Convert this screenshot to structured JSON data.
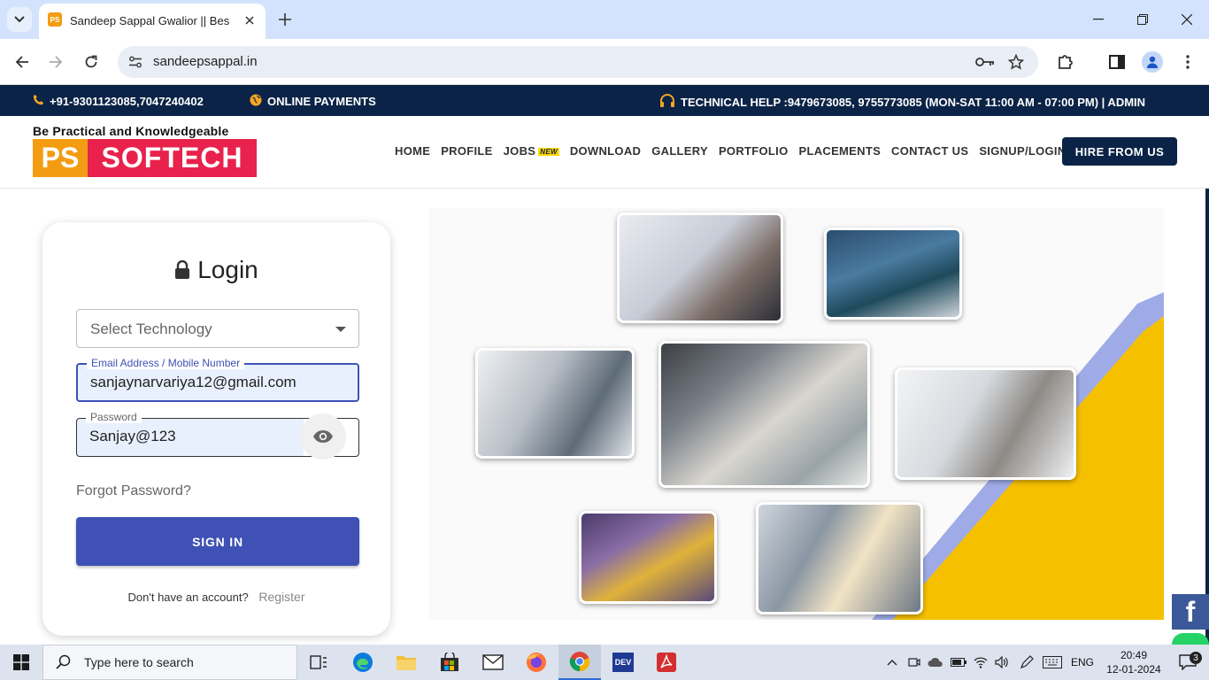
{
  "browser": {
    "tab_title": "Sandeep Sappal Gwalior || Best",
    "url": "sandeepsappal.in"
  },
  "topbar": {
    "phone": "+91-9301123085,7047240402",
    "payments": "ONLINE PAYMENTS",
    "help": "TECHNICAL HELP :9479673085, 9755773085 (MON-SAT 11:00 AM - 07:00 PM) | ADMIN"
  },
  "header": {
    "tagline": "Be Practical and Knowledgeable",
    "logo_ps": "PS",
    "logo_softech": "SOFTECH",
    "nav": {
      "home": "HOME",
      "profile": "PROFILE",
      "jobs": "JOBS",
      "jobs_badge": "NEW",
      "download": "DOWNLOAD",
      "gallery": "GALLERY",
      "portfolio": "PORTFOLIO",
      "placements": "PLACEMENTS",
      "contact": "CONTACT US",
      "signup": "SIGNUP/LOGIN"
    },
    "hire_button": "HIRE FROM US"
  },
  "login": {
    "title": "Login",
    "technology_placeholder": "Select Technology",
    "email_label": "Email Address / Mobile Number",
    "email_value": "sanjaynarvariya12@gmail.com",
    "password_label": "Password",
    "password_value": "Sanjay@123",
    "forgot": "Forgot Password?",
    "signin": "SIGN IN",
    "no_account": "Don't have an account?",
    "register": "Register"
  },
  "social": {
    "facebook_glyph": "f"
  },
  "taskbar": {
    "search_placeholder": "Type here to search",
    "language": "ENG",
    "time": "20:49",
    "date": "12-01-2024",
    "notifications": "3",
    "dev_label": "DEV"
  },
  "colors": {
    "navy": "#0b2346",
    "brand_orange": "#f39c12",
    "brand_red": "#e8224c",
    "primary_blue": "#3f51b5",
    "accent_yellow": "#f5c000"
  }
}
